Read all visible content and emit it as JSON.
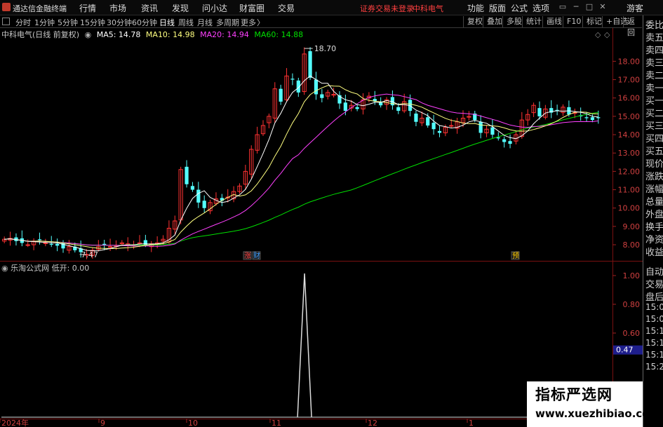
{
  "titlebar": {
    "app_name": "通达信金融终端",
    "menus": [
      "行情",
      "市场",
      "资讯",
      "发现",
      "问小达",
      "财富圈",
      "交易"
    ],
    "warning": "证券交易未登录",
    "stock_title": "中科电气",
    "right_menus": [
      "功能",
      "版面",
      "公式",
      "选项"
    ],
    "guest": "游客"
  },
  "toolbar": {
    "periods": [
      "分时",
      "1分钟",
      "5分钟",
      "15分钟",
      "30分钟",
      "60分钟",
      "日线",
      "周线",
      "月线",
      "多周期",
      "更多"
    ],
    "active_period": "日线",
    "right_buttons": [
      "复权",
      "叠加",
      "多股",
      "统计",
      "画线",
      "F10",
      "标记",
      "+自选",
      "返回"
    ]
  },
  "main_legend": {
    "stock": "中科电气(日线 前复权)",
    "ma5": "MA5: 14.78",
    "ma10": "MA10: 14.98",
    "ma20": "MA20: 14.94",
    "ma60": "MA60: 14.88"
  },
  "sub_legend": {
    "indicator": "乐淘公式网",
    "value": "低开: 0.00"
  },
  "annotations": {
    "high": "18.70",
    "low": "7.47",
    "event1": "涨",
    "event2": "财",
    "event3": "预"
  },
  "price_axis": [
    "18.00",
    "17.00",
    "16.00",
    "15.00",
    "14.00",
    "13.00",
    "12.00",
    "11.00",
    "10.00",
    "9.00",
    "8.00"
  ],
  "sub_axis": [
    "1.00",
    "0.80",
    "0.60",
    "0.47"
  ],
  "time_axis": [
    "2024年",
    "9",
    "10",
    "11",
    "12",
    "1"
  ],
  "side_panel": {
    "labels": [
      "委比",
      "卖五",
      "卖四",
      "卖三",
      "卖二",
      "卖一",
      "买一",
      "买二",
      "买三",
      "买四",
      "买五",
      "现价",
      "涨跌",
      "涨幅",
      "总量",
      "外盘",
      "换手",
      "净资",
      "收益",
      "自动",
      "交易",
      "盘后"
    ],
    "times": [
      "15:00",
      "15:08",
      "15:13",
      "15:18",
      "15:19",
      "15:26"
    ]
  },
  "watermark": {
    "title": "指标严选网",
    "url": "www.xuezhibiao.com"
  },
  "colors": {
    "up": "#ff3232",
    "down": "#54ffff",
    "ma5": "#ffffff",
    "ma10": "#ffff80",
    "ma20": "#ff40ff",
    "ma60": "#00e000",
    "highlight": "#1e1e8c"
  },
  "chart_data": {
    "type": "candlestick",
    "title": "中科电气(日线 前复权)",
    "ylim": [
      7.2,
      19.2
    ],
    "high": 18.7,
    "low": 7.47,
    "close_series": [
      8.3,
      8.35,
      8.2,
      8.1,
      8.0,
      8.2,
      8.25,
      8.1,
      8.0,
      7.95,
      7.8,
      7.9,
      7.7,
      7.6,
      7.47,
      7.7,
      7.9,
      8.0,
      7.9,
      7.95,
      8.1,
      8.05,
      8.0,
      8.1,
      8.0,
      8.05,
      8.1,
      8.3,
      8.9,
      9.3,
      12.1,
      11.3,
      11.0,
      10.3,
      10.0,
      10.3,
      10.5,
      10.4,
      10.6,
      10.9,
      11.2,
      12.0,
      13.2,
      14.0,
      14.5,
      15.0,
      16.5,
      15.8,
      17.2,
      17.0,
      16.3,
      18.4,
      17.1,
      16.2,
      16.0,
      16.3,
      16.2,
      15.7,
      15.3,
      15.6,
      15.4,
      15.9,
      16.1,
      15.8,
      15.6,
      15.9,
      15.6,
      15.3,
      15.8,
      15.3,
      14.7,
      14.9,
      14.5,
      14.3,
      14.1,
      14.4,
      14.5,
      14.7,
      14.9,
      15.0,
      14.8,
      14.1,
      14.3,
      14.0,
      13.8,
      13.6,
      13.5,
      14.0,
      14.8,
      15.1,
      15.6,
      15.0,
      15.4,
      15.2,
      15.3,
      15.5,
      15.1,
      15.2,
      15.0,
      14.9,
      14.8,
      14.9
    ]
  }
}
